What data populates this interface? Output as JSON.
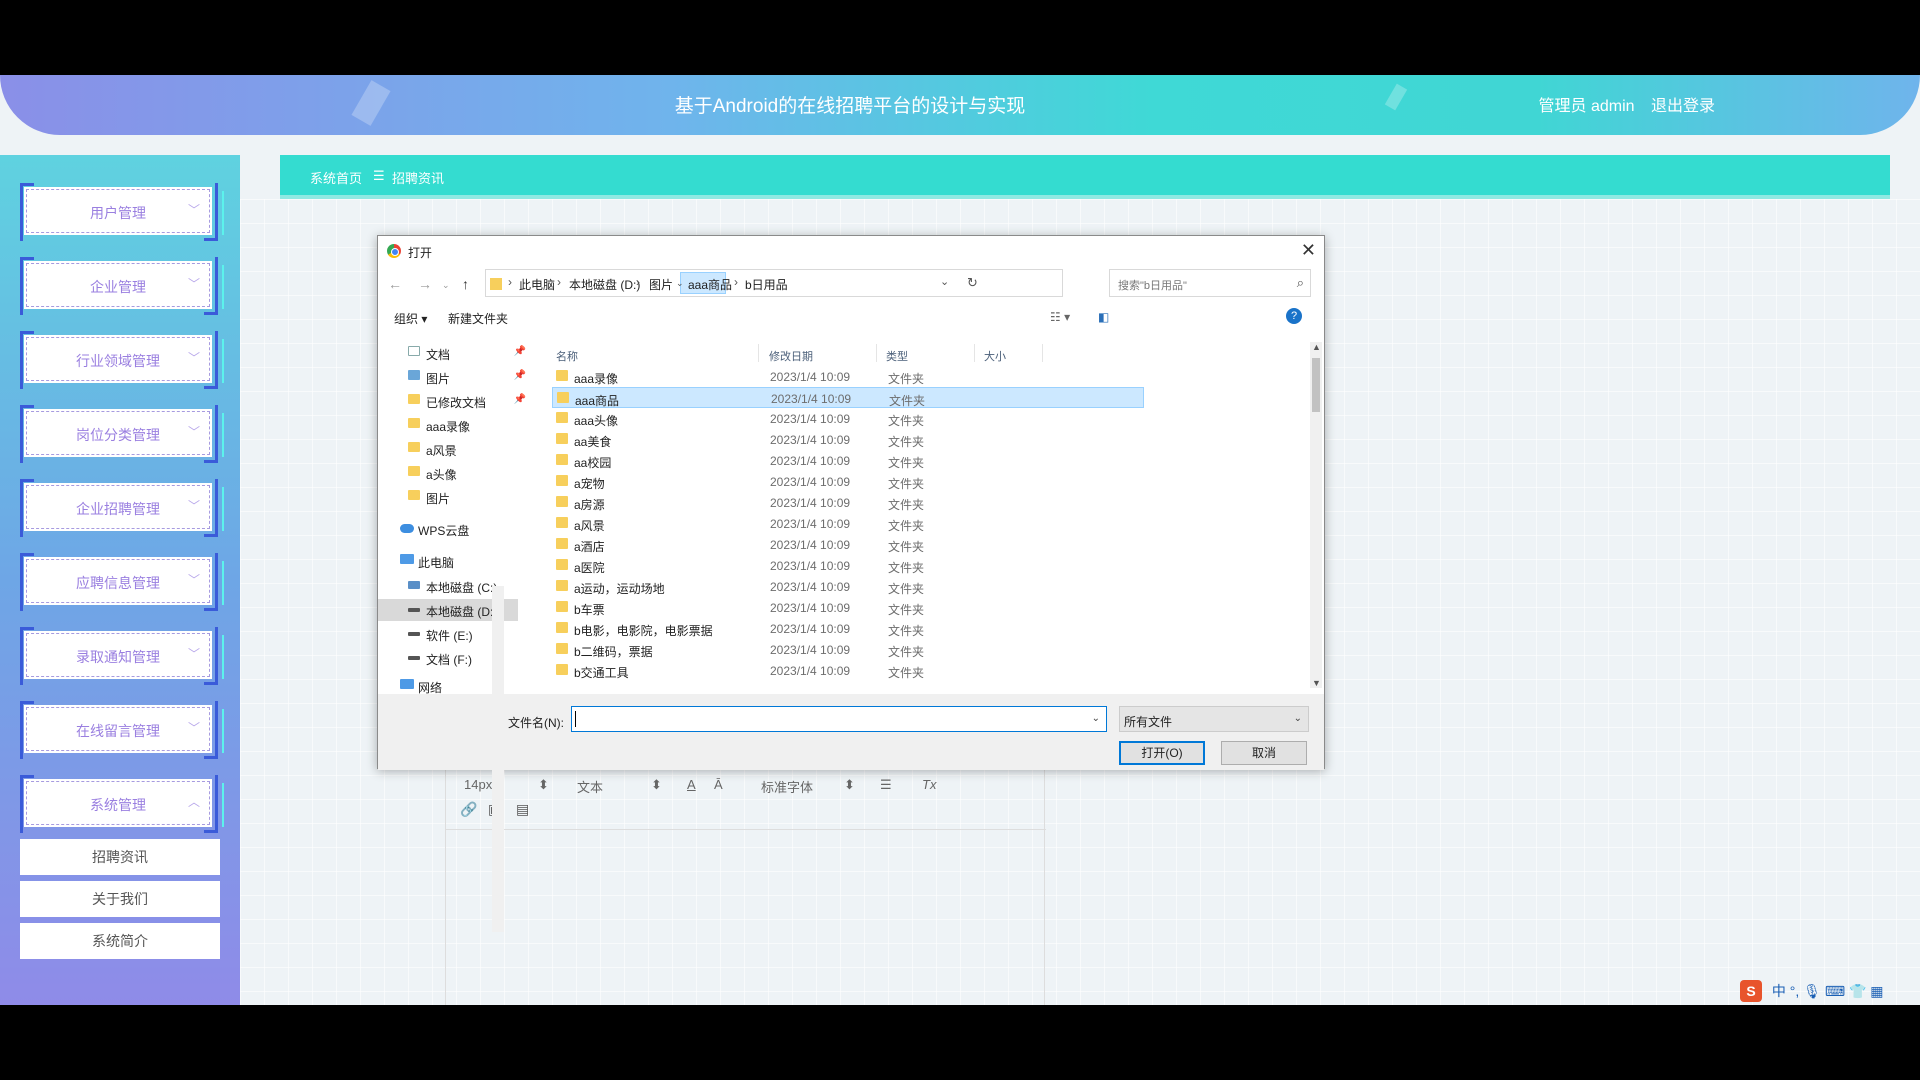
{
  "header": {
    "title": "基于Android的在线招聘平台的设计与实现",
    "user": "管理员 admin",
    "logout": "退出登录"
  },
  "sidebar": {
    "menus": [
      "用户管理",
      "企业管理",
      "行业领域管理",
      "岗位分类管理",
      "企业招聘管理",
      "应聘信息管理",
      "录取通知管理",
      "在线留言管理",
      "系统管理"
    ],
    "sub_items": [
      "招聘资讯",
      "关于我们",
      "系统简介"
    ]
  },
  "breadcrumb": {
    "home": "系统首页",
    "sep": "☰",
    "current": "招聘资讯"
  },
  "editor": {
    "size": "14px",
    "block": "文本",
    "font": "标准字体"
  },
  "dialog": {
    "title": "打开",
    "path": [
      "此电脑",
      "本地磁盘 (D:)",
      "图片",
      "aaa商品",
      "b日用品"
    ],
    "search_placeholder": "搜索\"b日用品\"",
    "organize": "组织 ▾",
    "new_folder": "新建文件夹",
    "nav": [
      {
        "label": "文档",
        "icon": "doc"
      },
      {
        "label": "图片",
        "icon": "img"
      },
      {
        "label": "已修改文档",
        "icon": "folder"
      },
      {
        "label": "aaa录像",
        "icon": "folder"
      },
      {
        "label": "a风景",
        "icon": "folder"
      },
      {
        "label": "a头像",
        "icon": "folder"
      },
      {
        "label": "图片",
        "icon": "folder"
      },
      {
        "label": "WPS云盘",
        "icon": "cloud"
      },
      {
        "label": "此电脑",
        "icon": "pc"
      },
      {
        "label": "本地磁盘 (C:)",
        "icon": "drivec"
      },
      {
        "label": "本地磁盘 (D:)",
        "icon": "drive"
      },
      {
        "label": "软件 (E:)",
        "icon": "drive"
      },
      {
        "label": "文档 (F:)",
        "icon": "drive"
      },
      {
        "label": "网络",
        "icon": "pc"
      }
    ],
    "columns": [
      "名称",
      "修改日期",
      "类型",
      "大小"
    ],
    "files": [
      {
        "name": "aaa录像",
        "date": "2023/1/4 10:09",
        "type": "文件夹"
      },
      {
        "name": "aaa商品",
        "date": "2023/1/4 10:09",
        "type": "文件夹"
      },
      {
        "name": "aaa头像",
        "date": "2023/1/4 10:09",
        "type": "文件夹"
      },
      {
        "name": "aa美食",
        "date": "2023/1/4 10:09",
        "type": "文件夹"
      },
      {
        "name": "aa校园",
        "date": "2023/1/4 10:09",
        "type": "文件夹"
      },
      {
        "name": "a宠物",
        "date": "2023/1/4 10:09",
        "type": "文件夹"
      },
      {
        "name": "a房源",
        "date": "2023/1/4 10:09",
        "type": "文件夹"
      },
      {
        "name": "a风景",
        "date": "2023/1/4 10:09",
        "type": "文件夹"
      },
      {
        "name": "a酒店",
        "date": "2023/1/4 10:09",
        "type": "文件夹"
      },
      {
        "name": "a医院",
        "date": "2023/1/4 10:09",
        "type": "文件夹"
      },
      {
        "name": "a运动，运动场地",
        "date": "2023/1/4 10:09",
        "type": "文件夹"
      },
      {
        "name": "b车票",
        "date": "2023/1/4 10:09",
        "type": "文件夹"
      },
      {
        "name": "b电影，电影院，电影票据",
        "date": "2023/1/4 10:09",
        "type": "文件夹"
      },
      {
        "name": "b二维码，票据",
        "date": "2023/1/4 10:09",
        "type": "文件夹"
      },
      {
        "name": "b交通工具",
        "date": "2023/1/4 10:09",
        "type": "文件夹"
      }
    ],
    "filename_label": "文件名(N):",
    "filename_value": "",
    "filetype": "所有文件",
    "open": "打开(O)",
    "cancel": "取消"
  },
  "ime": {
    "lang": "中"
  }
}
